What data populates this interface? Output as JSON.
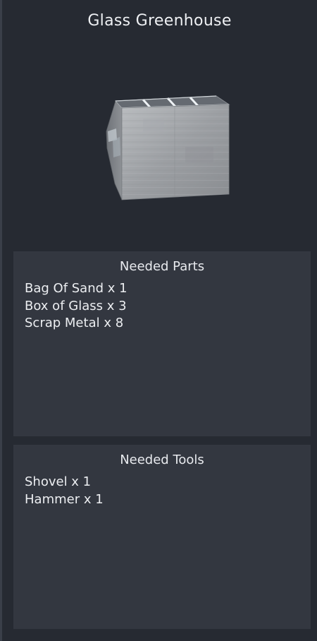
{
  "item": {
    "title": "Glass Greenhouse",
    "preview_icon": "glass-greenhouse-model"
  },
  "parts": {
    "header": "Needed Parts",
    "items": [
      {
        "label": "Bag Of Sand x 1"
      },
      {
        "label": "Box of Glass x 3"
      },
      {
        "label": "Scrap Metal x 8"
      }
    ]
  },
  "tools": {
    "header": "Needed Tools",
    "items": [
      {
        "label": "Shovel x 1"
      },
      {
        "label": "Hammer x 1"
      }
    ]
  }
}
